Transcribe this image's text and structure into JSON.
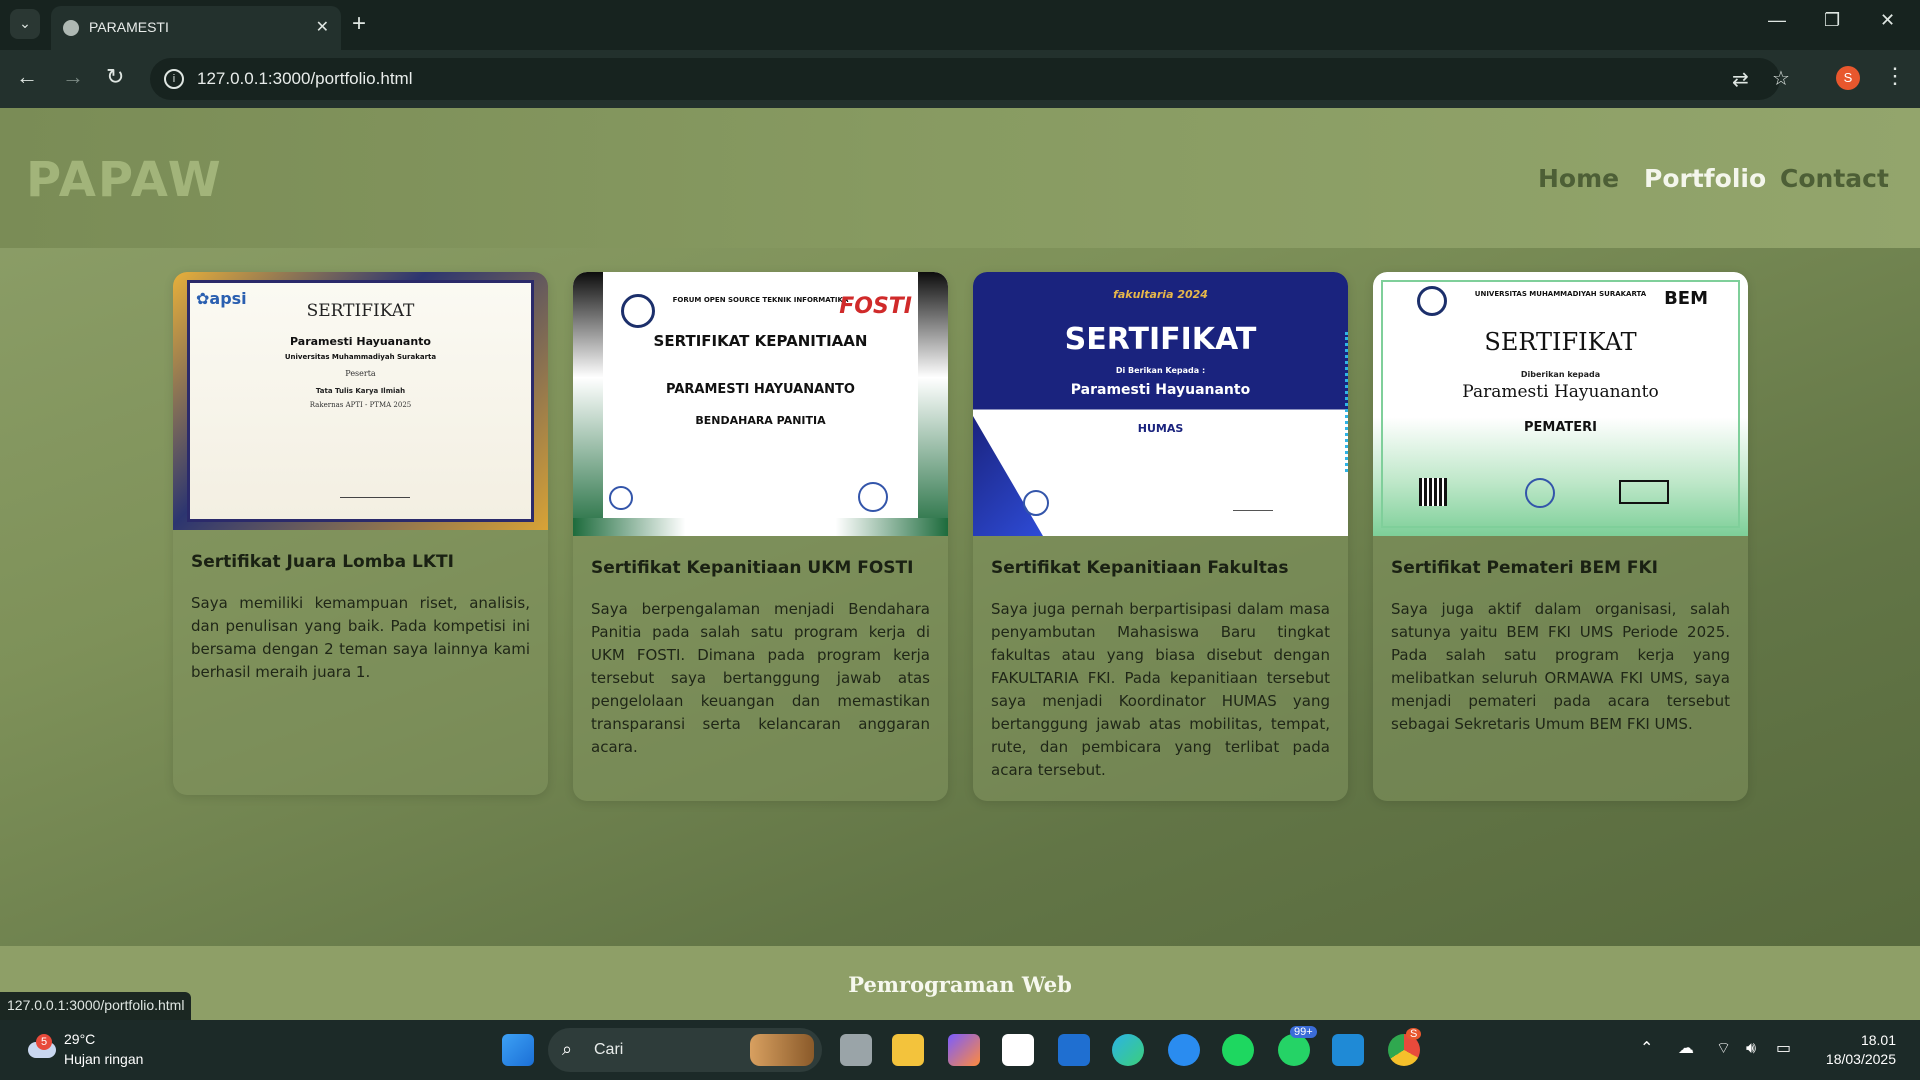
{
  "browser": {
    "tab_title": "PARAMESTI",
    "url": "127.0.0.1:3000/portfolio.html",
    "profile_initial": "S"
  },
  "site": {
    "logo": "PAPAW",
    "nav": [
      {
        "label": "Home",
        "active": false
      },
      {
        "label": "Portfolio",
        "active": true
      },
      {
        "label": "Contact",
        "active": false
      }
    ]
  },
  "cards": [
    {
      "title": "Sertifikat Juara Lomba LKTI",
      "text": "Saya memiliki kemampuan riset, analisis, dan penulisan yang baik. Pada kompetisi ini bersama dengan 2 teman saya lainnya kami berhasil meraih juara 1.",
      "cert": {
        "heading": "SERTIFIKAT",
        "name": "Paramesti Hayuananto",
        "line1": "Universitas Muhammadiyah Surakarta",
        "line2": "Peserta",
        "line3": "Tata Tulis Karya Ilmiah",
        "line4": "Rakernas APTI - PTMA 2025"
      }
    },
    {
      "title": "Sertifikat Kepanitiaan UKM FOSTI",
      "text": "Saya berpengalaman menjadi Bendahara Panitia pada salah satu program kerja di UKM FOSTI. Dimana pada program kerja tersebut saya bertanggung jawab atas pengelolaan keuangan dan memastikan transparansi serta kelancaran anggaran acara.",
      "cert": {
        "heading": "SERTIFIKAT KEPANITIAAN",
        "org": "FORUM OPEN SOURCE TEKNIK INFORMATIKA",
        "name": "PARAMESTI HAYUANANTO",
        "role": "BENDAHARA PANITIA",
        "logo": "FOSTI"
      }
    },
    {
      "title": "Sertifikat Kepanitiaan Fakultas",
      "text": "Saya juga pernah berpartisipasi dalam masa penyambutan Mahasiswa Baru tingkat fakultas atau yang biasa disebut dengan FAKULTARIA FKI. Pada kepanitiaan tersebut saya menjadi Koordinator HUMAS yang bertanggung jawab atas mobilitas, tempat, rute, dan pembicara yang terlibat pada acara tersebut.",
      "cert": {
        "event": "fakultaria 2024",
        "heading": "SERTIFIKAT",
        "given": "Di Berikan Kepada :",
        "name": "Paramesti Hayuananto",
        "role": "HUMAS"
      }
    },
    {
      "title": "Sertifikat Pemateri BEM FKI",
      "text": "Saya juga aktif dalam organisasi, salah satunya yaitu BEM FKI UMS Periode 2025. Pada salah satu program kerja yang melibatkan seluruh ORMAWA FKI UMS, saya menjadi pemateri pada acara tersebut sebagai Sekretaris Umum BEM FKI UMS.",
      "cert": {
        "org": "UNIVERSITAS MUHAMMADIYAH SURAKARTA",
        "heading": "SERTIFIKAT",
        "given": "Diberikan kepada",
        "name": "Paramesti Hayuananto",
        "role": "PEMATERI",
        "logo": "BEM"
      }
    }
  ],
  "footer": {
    "text": "Pemrograman Web"
  },
  "status_bar": {
    "url": "127.0.0.1:3000/portfolio.html"
  },
  "taskbar": {
    "weather_temp": "29°C",
    "weather_desc": "Hujan ringan",
    "weather_badge": "5",
    "search_placeholder": "Cari",
    "whatsapp_badge": "99+",
    "chrome_badge": "S",
    "time": "18.01",
    "date": "18/03/2025"
  }
}
